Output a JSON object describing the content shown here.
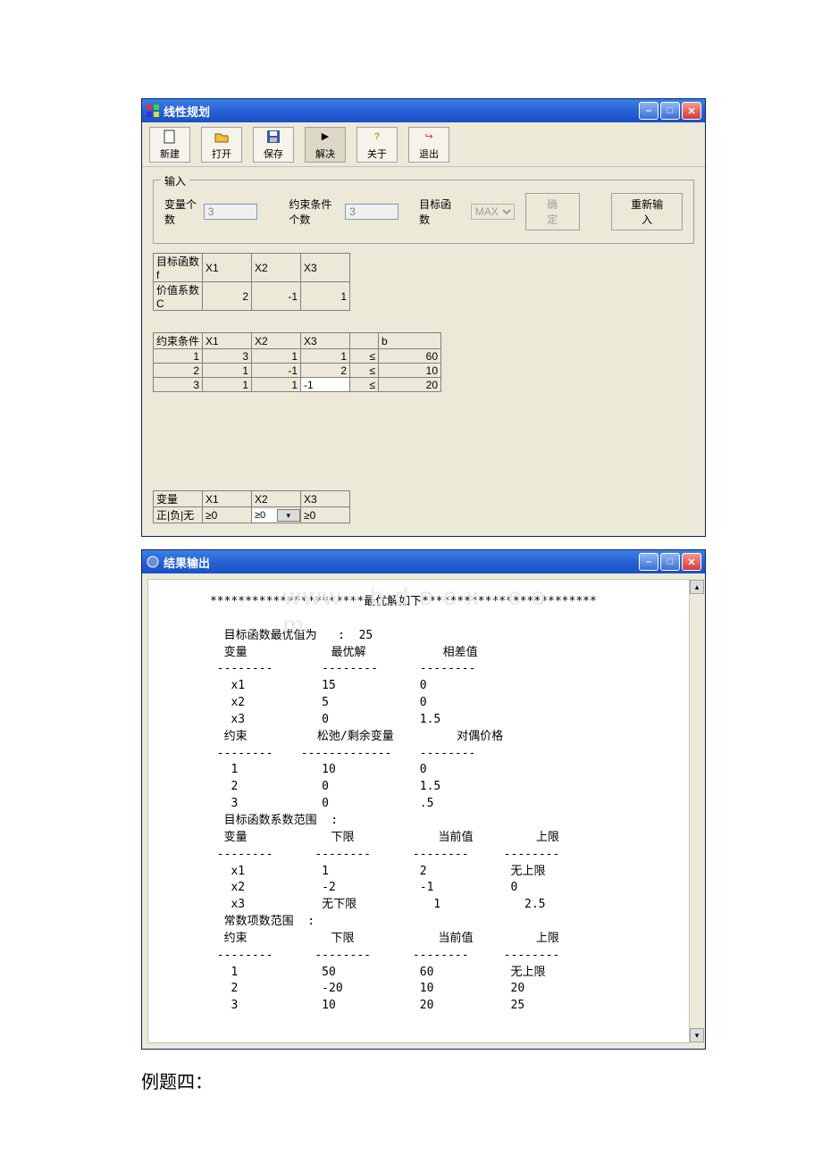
{
  "window1": {
    "title": "线性规划",
    "toolbar": {
      "new": "新建",
      "open": "打开",
      "save": "保存",
      "solve": "解决",
      "about": "关于",
      "exit": "退出"
    },
    "input_legend": "输入",
    "var_count_label": "变量个数",
    "var_count": "3",
    "constr_count_label": "约束条件个数",
    "constr_count": "3",
    "obj_label": "目标函数",
    "obj_type": "MAX",
    "ok_btn": "确定",
    "reset_btn": "重新输入",
    "obj_table": {
      "row1_label": "目标函数f",
      "row2_label": "价值系数C",
      "headers": [
        "X1",
        "X2",
        "X3"
      ],
      "values": [
        "2",
        "-1",
        "1"
      ]
    },
    "constr_table": {
      "label": "约束条件",
      "headers": [
        "X1",
        "X2",
        "X3"
      ],
      "b_header": "b",
      "rows": [
        {
          "idx": "1",
          "vals": [
            "3",
            "1",
            "1"
          ],
          "op": "≤",
          "b": "60"
        },
        {
          "idx": "2",
          "vals": [
            "1",
            "-1",
            "2"
          ],
          "op": "≤",
          "b": "10"
        },
        {
          "idx": "3",
          "vals": [
            "1",
            "1",
            "-1"
          ],
          "op": "≤",
          "b": "20"
        }
      ],
      "row3_x3_edit": "-1"
    },
    "sign_table": {
      "label": "变量",
      "sublabel": "正|负|无",
      "headers": [
        "X1",
        "X2",
        "X3"
      ],
      "vals": [
        "≥0",
        "≥0",
        "≥0"
      ]
    }
  },
  "window2": {
    "title": "结果输出",
    "header_line": "**********************最优解如下*************************",
    "opt_label": "目标函数最优值为",
    "opt_value": "25",
    "sec1_h": [
      "变量",
      "最优解",
      "相差值"
    ],
    "sec1": [
      [
        "x1",
        "15",
        "0"
      ],
      [
        "x2",
        "5",
        "0"
      ],
      [
        "x3",
        "0",
        "1.5"
      ]
    ],
    "sec2_h": [
      "约束",
      "松弛/剩余变量",
      "对偶价格"
    ],
    "sec2": [
      [
        "1",
        "10",
        "0"
      ],
      [
        "2",
        "0",
        "1.5"
      ],
      [
        "3",
        "0",
        ".5"
      ]
    ],
    "coef_range_label": "目标函数系数范围  :",
    "sec3_h": [
      "变量",
      "下限",
      "当前值",
      "上限"
    ],
    "sec3": [
      [
        "x1",
        "1",
        "2",
        "无上限"
      ],
      [
        "x2",
        "-2",
        "-1",
        "0"
      ],
      [
        "x3",
        "无下限",
        "1",
        "2.5"
      ]
    ],
    "rhs_range_label": "常数项数范围  :",
    "sec4_h": [
      "约束",
      "下限",
      "当前值",
      "上限"
    ],
    "sec4": [
      [
        "1",
        "50",
        "60",
        "无上限"
      ],
      [
        "2",
        "-20",
        "10",
        "20"
      ],
      [
        "3",
        "10",
        "20",
        "25"
      ]
    ]
  },
  "watermark": "www · b d o c x · c o m",
  "caption": "例题四："
}
